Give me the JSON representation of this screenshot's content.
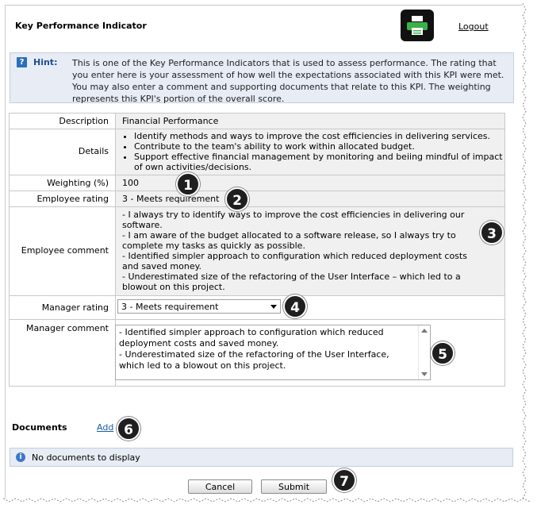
{
  "page": {
    "title": "Key Performance Indicator",
    "logout_label": "Logout",
    "print_icon": "printer-icon"
  },
  "hint": {
    "label": "Hint:",
    "text": "This is one of the Key Performance Indicators that is used to assess performance. The rating that you enter here is your assessment of how well the expectations associated with this KPI were met. You may also enter a comment and supporting documents that relate to this KPI. The weighting represents this KPI's portion of the overall score."
  },
  "form": {
    "description_label": "Description",
    "description_value": "Financial Performance",
    "details_label": "Details",
    "details_items": [
      "Identify methods and ways to improve the cost efficiencies in delivering services.",
      "Contribute to the team's ability to work within allocated budget.",
      "Support effective financial management by monitoring and beiing mindful of impact of own activities/decisions."
    ],
    "weighting_label": "Weighting (%)",
    "weighting_value": "100",
    "employee_rating_label": "Employee rating",
    "employee_rating_value": "3 - Meets requirement",
    "employee_comment_label": "Employee comment",
    "employee_comment_lines": [
      "- I always try to identify ways to improve the cost efficiencies in delivering our software.",
      "- I am aware of the budget allocated to a software release, so I always try to complete my tasks as quickly as possible.",
      "- Identified simpler approach to configuration which reduced deployment costs and saved money.",
      "- Underestimated size of the refactoring of the User Interface – which led to a blowout on this project."
    ],
    "manager_rating_label": "Manager rating",
    "manager_rating_value": "3 - Meets requirement",
    "manager_comment_label": "Manager comment",
    "manager_comment_value": "- Identified simpler approach to configuration which reduced deployment costs and saved money.\n- Underestimated size of the refactoring of the User Interface, which led to a blowout on this project."
  },
  "documents": {
    "title": "Documents",
    "add_label": "Add",
    "empty_text": "No documents to display"
  },
  "buttons": {
    "cancel": "Cancel",
    "submit": "Submit"
  },
  "markers": [
    "1",
    "2",
    "3",
    "4",
    "5",
    "6",
    "7"
  ]
}
